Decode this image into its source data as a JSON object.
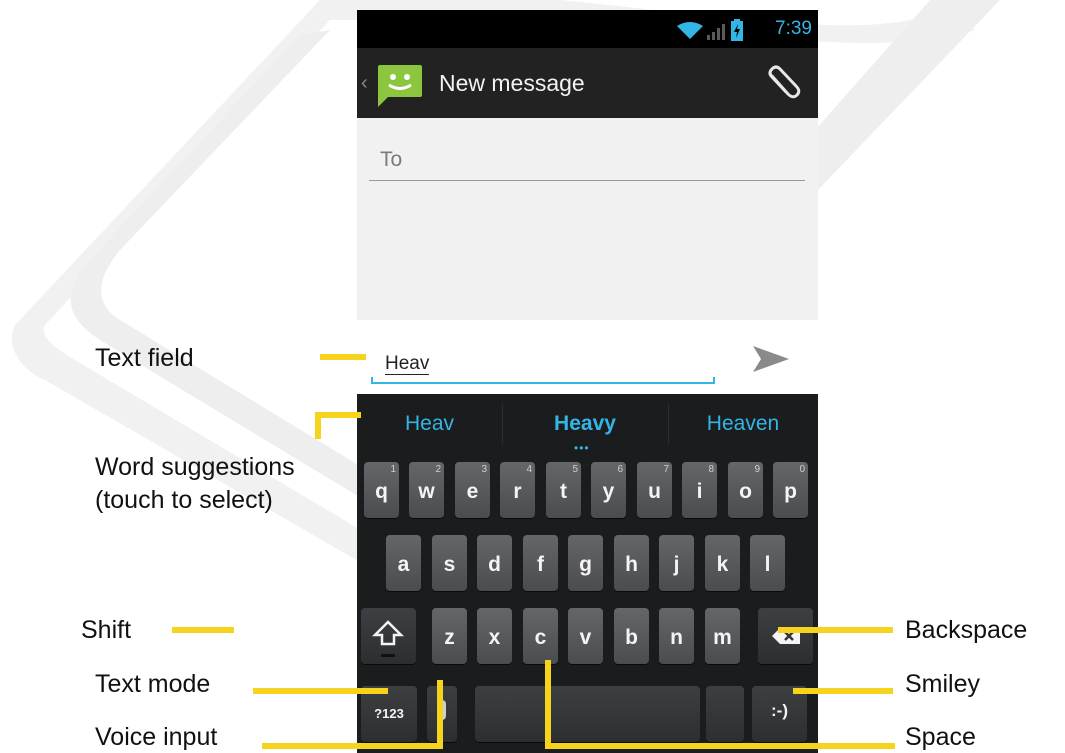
{
  "status_bar": {
    "time": "7:39"
  },
  "action_bar": {
    "title": "New message"
  },
  "compose": {
    "to_placeholder": "To",
    "message_text": "Heav"
  },
  "keyboard": {
    "suggestions": [
      "Heav",
      "Heavy",
      "Heaven"
    ],
    "row1": [
      {
        "key": "q",
        "num": "1"
      },
      {
        "key": "w",
        "num": "2"
      },
      {
        "key": "e",
        "num": "3"
      },
      {
        "key": "r",
        "num": "4"
      },
      {
        "key": "t",
        "num": "5"
      },
      {
        "key": "y",
        "num": "6"
      },
      {
        "key": "u",
        "num": "7"
      },
      {
        "key": "i",
        "num": "8"
      },
      {
        "key": "o",
        "num": "9"
      },
      {
        "key": "p",
        "num": "0"
      }
    ],
    "row2": [
      "a",
      "s",
      "d",
      "f",
      "g",
      "h",
      "j",
      "k",
      "l"
    ],
    "row3": [
      "z",
      "x",
      "c",
      "v",
      "b",
      "n",
      "m"
    ],
    "mode_key_label": "?123",
    "smiley_key_label": ":-)"
  },
  "annotations": {
    "text_field": "Text field",
    "word_suggestions_line1": "Word suggestions",
    "word_suggestions_line2": "(touch to select)",
    "shift": "Shift",
    "text_mode": "Text mode",
    "voice_input": "Voice input",
    "backspace": "Backspace",
    "smiley": "Smiley",
    "space": "Space"
  },
  "icons": [
    "wifi-icon",
    "signal-icon",
    "battery-icon",
    "back-icon",
    "messaging-app-icon",
    "attachment-icon",
    "send-icon",
    "shift-icon",
    "backspace-icon",
    "microphone-icon"
  ],
  "colors": {
    "accent": "#33b5e5",
    "callout": "#f6d31c",
    "keyboard_bg": "#1b1c1e",
    "action_bar": "#222222"
  }
}
